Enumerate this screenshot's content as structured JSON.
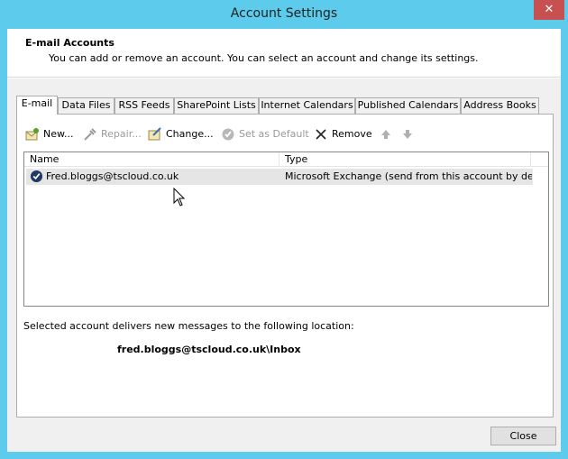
{
  "window": {
    "title": "Account Settings",
    "close_glyph": "✕"
  },
  "header": {
    "title": "E-mail Accounts",
    "description": "You can add or remove an account. You can select an account and change its settings."
  },
  "tabs": [
    {
      "label": "E-mail",
      "active": true
    },
    {
      "label": "Data Files",
      "active": false
    },
    {
      "label": "RSS Feeds",
      "active": false
    },
    {
      "label": "SharePoint Lists",
      "active": false
    },
    {
      "label": "Internet Calendars",
      "active": false
    },
    {
      "label": "Published Calendars",
      "active": false
    },
    {
      "label": "Address Books",
      "active": false
    }
  ],
  "toolbar": {
    "new_label": "New...",
    "repair_label": "Repair...",
    "change_label": "Change...",
    "set_default_label": "Set as Default",
    "remove_label": "Remove",
    "icons": [
      "new-account-icon",
      "repair-icon",
      "change-icon",
      "set-default-icon",
      "remove-icon",
      "move-up-icon",
      "move-down-icon"
    ]
  },
  "accounts_list": {
    "columns": [
      "Name",
      "Type"
    ],
    "rows": [
      {
        "name": "Fred.bloggs@tscloud.co.uk",
        "type": "Microsoft Exchange (send from this account by def..."
      }
    ]
  },
  "delivery": {
    "label": "Selected account delivers new messages to the following location:",
    "location": "fred.bloggs@tscloud.co.uk\\Inbox"
  },
  "footer": {
    "close_label": "Close"
  },
  "colors": {
    "title_bar": "#5ccbec",
    "close_button": "#c75050",
    "dialog_bg": "#f0f0f0",
    "selected_row": "#e5e5e5"
  }
}
